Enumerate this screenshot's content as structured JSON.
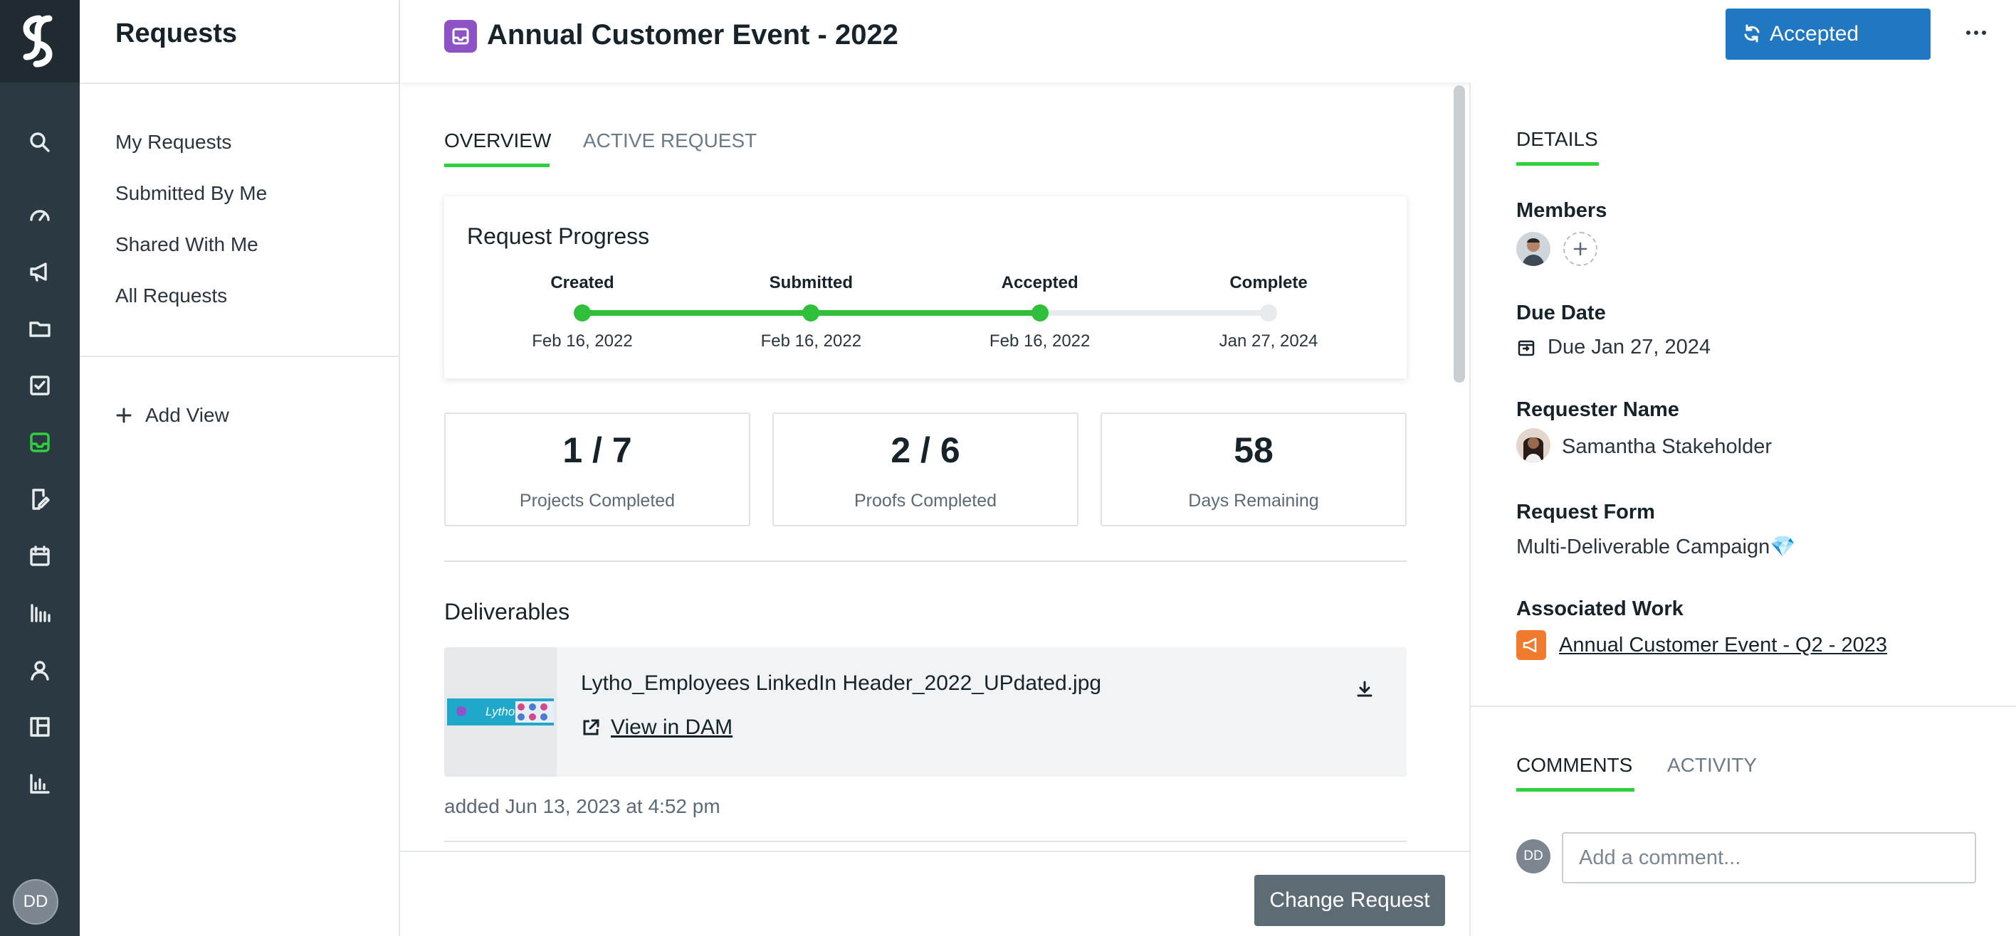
{
  "nav": {
    "title": "Requests",
    "items": [
      "My Requests",
      "Submitted By Me",
      "Shared With Me",
      "All Requests"
    ],
    "add_view": "Add View"
  },
  "rail": {
    "icons": [
      "search-icon",
      "dashboard-icon",
      "campaign-icon",
      "folder-icon",
      "tasks-icon",
      "requests-icon",
      "proofs-icon",
      "calendar-icon",
      "workload-icon",
      "people-icon",
      "templates-icon",
      "reports-icon"
    ],
    "active": "requests-icon",
    "avatar": "DD"
  },
  "header": {
    "title": "Annual Customer Event - 2022",
    "status_button": "Accepted",
    "accent": "#1f78c1"
  },
  "tabs": {
    "overview": "OVERVIEW",
    "active_request": "ACTIVE REQUEST"
  },
  "progress": {
    "title": "Request Progress",
    "fraction_complete": 0.667,
    "steps": [
      {
        "label": "Created",
        "date": "Feb 16, 2022",
        "done": true
      },
      {
        "label": "Submitted",
        "date": "Feb 16, 2022",
        "done": true
      },
      {
        "label": "Accepted",
        "date": "Feb 16, 2022",
        "done": true
      },
      {
        "label": "Complete",
        "date": "Jan 27, 2024",
        "done": false
      }
    ],
    "done_color": "#2fbf3a",
    "todo_color": "#e8ebee"
  },
  "stats": [
    {
      "value": "1 / 7",
      "label": "Projects Completed"
    },
    {
      "value": "2 / 6",
      "label": "Proofs Completed"
    },
    {
      "value": "58",
      "label": "Days Remaining"
    }
  ],
  "deliverables": {
    "title": "Deliverables",
    "file_name": "Lytho_Employees LinkedIn Header_2022_UPdated.jpg",
    "view_link": "View in DAM",
    "added": "added Jun 13, 2023 at 4:52 pm",
    "thumb_text": "Lytho"
  },
  "bottom": {
    "change_button": "Change Request"
  },
  "details": {
    "tab": "DETAILS",
    "members_label": "Members",
    "due_label": "Due Date",
    "due_value": "Due Jan 27, 2024",
    "requester_label": "Requester Name",
    "requester_value": "Samantha Stakeholder",
    "form_label": "Request Form",
    "form_value": "Multi-Deliverable Campaign💎",
    "assoc_label": "Associated Work",
    "assoc_value": "Annual Customer Event - Q2 - 2023"
  },
  "comments": {
    "tab_comments": "COMMENTS",
    "tab_activity": "ACTIVITY",
    "avatar": "DD",
    "placeholder": "Add a comment..."
  }
}
